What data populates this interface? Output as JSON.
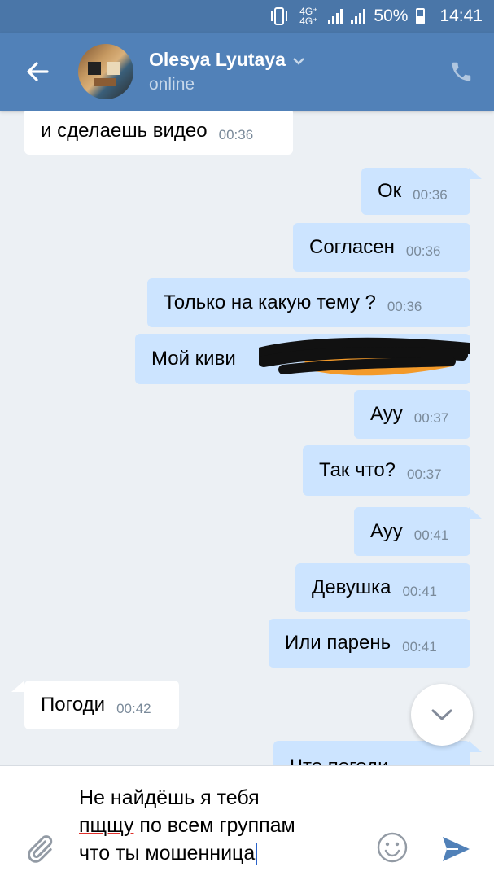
{
  "status_bar": {
    "network_label": "4G⁺ 4G⁺",
    "battery": "50%",
    "time": "14:41"
  },
  "header": {
    "contact_name": "Olesya Lyutaya",
    "status": "online"
  },
  "messages": [
    {
      "direction": "in",
      "text": "и сделаешь видео",
      "time": "00:36"
    },
    {
      "direction": "out",
      "text": "Ок",
      "time": "00:36"
    },
    {
      "direction": "out",
      "text": "Согласен",
      "time": "00:36"
    },
    {
      "direction": "out",
      "text": "Только на какую тему ?",
      "time": "00:36"
    },
    {
      "direction": "out",
      "text": "Мой киви",
      "time": ""
    },
    {
      "direction": "out",
      "text": "Ауу",
      "time": "00:37"
    },
    {
      "direction": "out",
      "text": "Так что?",
      "time": "00:37"
    },
    {
      "direction": "out",
      "text": "Ауу",
      "time": "00:41"
    },
    {
      "direction": "out",
      "text": "Девушка",
      "time": "00:41"
    },
    {
      "direction": "out",
      "text": "Или парень",
      "time": "00:41"
    },
    {
      "direction": "in",
      "text": "Погоди",
      "time": "00:42"
    },
    {
      "direction": "out",
      "text": "Что погоди",
      "time": ""
    }
  ],
  "composer": {
    "line1": "Не найдёшь я тебя",
    "line2_underlined": "пщщу",
    "line2_rest": " по всем группам",
    "line3": "что ты мошенница"
  },
  "colors": {
    "header": "#5181b8",
    "outgoing_bubble": "#cce4ff",
    "incoming_bubble": "#ffffff",
    "background": "#ecf0f4"
  },
  "icons": [
    "back-arrow-icon",
    "chevron-down-icon",
    "phone-icon",
    "scroll-down-icon",
    "paperclip-icon",
    "smiley-icon",
    "send-icon"
  ]
}
